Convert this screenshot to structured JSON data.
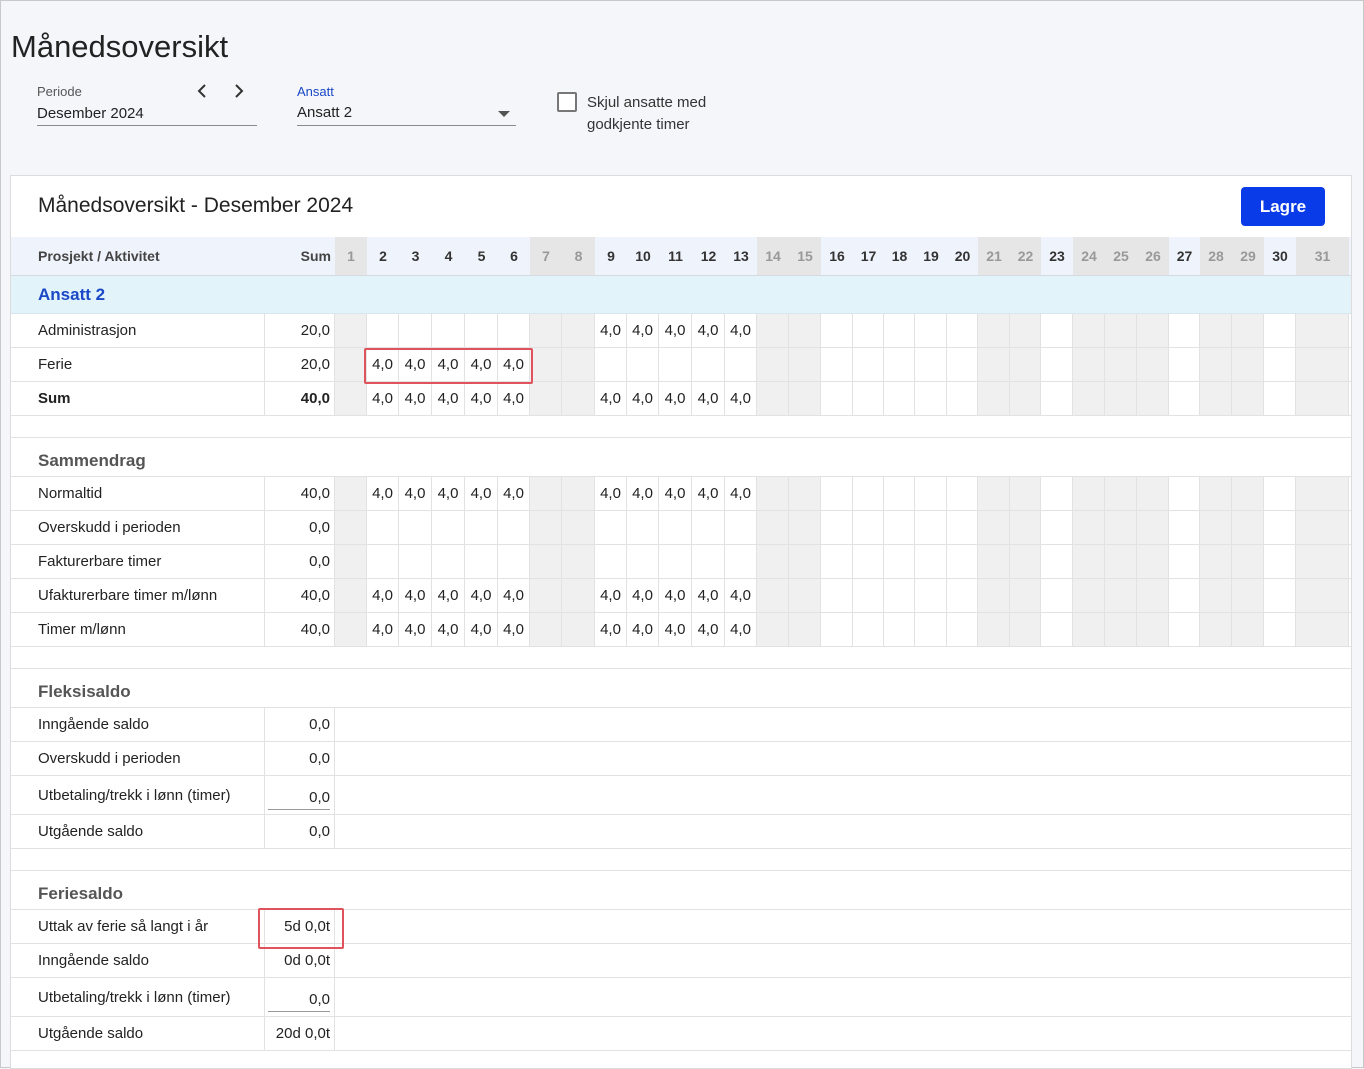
{
  "page": {
    "title": "Månedsoversikt"
  },
  "filters": {
    "period_label": "Periode",
    "period_value": "Desember 2024",
    "employee_label": "Ansatt",
    "employee_value": "Ansatt 2",
    "hide_checkbox_line1": "Skjul ansatte med",
    "hide_checkbox_line2": "godkjente timer",
    "hide_checked": false
  },
  "card": {
    "title": "Månedsoversikt - Desember 2024",
    "save_label": "Lagre"
  },
  "table": {
    "col_activity": "Prosjekt / Aktivitet",
    "col_sum": "Sum",
    "days": [
      "1",
      "2",
      "3",
      "4",
      "5",
      "6",
      "7",
      "8",
      "9",
      "10",
      "11",
      "12",
      "13",
      "14",
      "15",
      "16",
      "17",
      "18",
      "19",
      "20",
      "21",
      "22",
      "23",
      "24",
      "25",
      "26",
      "27",
      "28",
      "29",
      "30",
      "31"
    ],
    "weekend_days": [
      1,
      7,
      8,
      14,
      15,
      21,
      22,
      24,
      25,
      26,
      28,
      29,
      31
    ],
    "employee_name": "Ansatt 2",
    "activities": [
      {
        "label": "Administrasjon",
        "sum": "20,0",
        "values": {
          "9": "4,0",
          "10": "4,0",
          "11": "4,0",
          "12": "4,0",
          "13": "4,0"
        }
      },
      {
        "label": "Ferie",
        "sum": "20,0",
        "values": {
          "2": "4,0",
          "3": "4,0",
          "4": "4,0",
          "5": "4,0",
          "6": "4,0"
        }
      },
      {
        "label": "Sum",
        "sum": "40,0",
        "bold": true,
        "values": {
          "2": "4,0",
          "3": "4,0",
          "4": "4,0",
          "5": "4,0",
          "6": "4,0",
          "9": "4,0",
          "10": "4,0",
          "11": "4,0",
          "12": "4,0",
          "13": "4,0"
        }
      }
    ],
    "summary_title": "Sammendrag",
    "summary": [
      {
        "label": "Normaltid",
        "sum": "40,0",
        "values": {
          "2": "4,0",
          "3": "4,0",
          "4": "4,0",
          "5": "4,0",
          "6": "4,0",
          "9": "4,0",
          "10": "4,0",
          "11": "4,0",
          "12": "4,0",
          "13": "4,0"
        }
      },
      {
        "label": "Overskudd i perioden",
        "sum": "0,0",
        "values": {}
      },
      {
        "label": "Fakturerbare timer",
        "sum": "0,0",
        "values": {}
      },
      {
        "label": "Ufakturerbare timer m/lønn",
        "sum": "40,0",
        "values": {
          "2": "4,0",
          "3": "4,0",
          "4": "4,0",
          "5": "4,0",
          "6": "4,0",
          "9": "4,0",
          "10": "4,0",
          "11": "4,0",
          "12": "4,0",
          "13": "4,0"
        }
      },
      {
        "label": "Timer m/lønn",
        "sum": "40,0",
        "values": {
          "2": "4,0",
          "3": "4,0",
          "4": "4,0",
          "5": "4,0",
          "6": "4,0",
          "9": "4,0",
          "10": "4,0",
          "11": "4,0",
          "12": "4,0",
          "13": "4,0"
        }
      }
    ],
    "flex_title": "Fleksisaldo",
    "flex": [
      {
        "label": "Inngående saldo",
        "value": "0,0"
      },
      {
        "label": "Overskudd i perioden",
        "value": "0,0"
      },
      {
        "label": "Utbetaling/trekk i lønn (timer)",
        "value": "0,0",
        "editable": true
      },
      {
        "label": "Utgående saldo",
        "value": "0,0"
      }
    ],
    "vacation_title": "Feriesaldo",
    "vacation": [
      {
        "label": "Uttak av ferie så langt i år",
        "value": "5d 0,0t"
      },
      {
        "label": "Inngående saldo",
        "value": "0d 0,0t"
      },
      {
        "label": "Utbetaling/trekk i lønn (timer)",
        "value": "0,0",
        "editable": true
      },
      {
        "label": "Utgående saldo",
        "value": "20d 0,0t"
      }
    ]
  },
  "colors": {
    "accent": "#0a3be8",
    "employee_text": "#1a48c6",
    "highlight": "#e0525c"
  }
}
